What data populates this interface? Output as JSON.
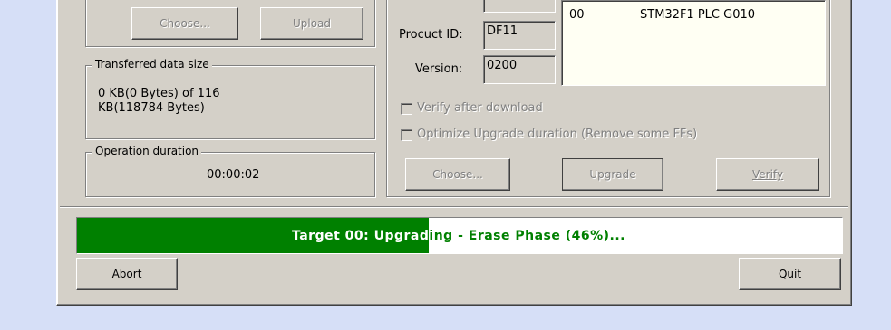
{
  "upload": {
    "choose_label": "Choose...",
    "upload_label": "Upload"
  },
  "transferred": {
    "group_title": "Transferred data size",
    "text": "0 KB(0 Bytes) of 116 KB(118784 Bytes)"
  },
  "duration": {
    "group_title": "Operation duration",
    "value": "00:00:02"
  },
  "device": {
    "product_id_label": "Procuct ID:",
    "product_id_value": "DF11",
    "version_label": "Version:",
    "version_value": "0200"
  },
  "targets": {
    "rows": [
      {
        "id": "00",
        "name": "STM32F1 PLC G010"
      }
    ]
  },
  "options": {
    "verify_after_download": "Verify after download",
    "optimize_upgrade": "Optimize Upgrade duration (Remove some FFs)"
  },
  "upgrade": {
    "choose_label": "Choose...",
    "upgrade_label": "Upgrade",
    "verify_label": "Verify"
  },
  "progress": {
    "text": "Target 00: Upgrading - Erase Phase (46%)...",
    "percent": 46,
    "fill_color": "#008000"
  },
  "footer": {
    "abort_label": "Abort",
    "quit_label": "Quit"
  },
  "icons": {
    "checkbox": "checkbox-empty"
  }
}
